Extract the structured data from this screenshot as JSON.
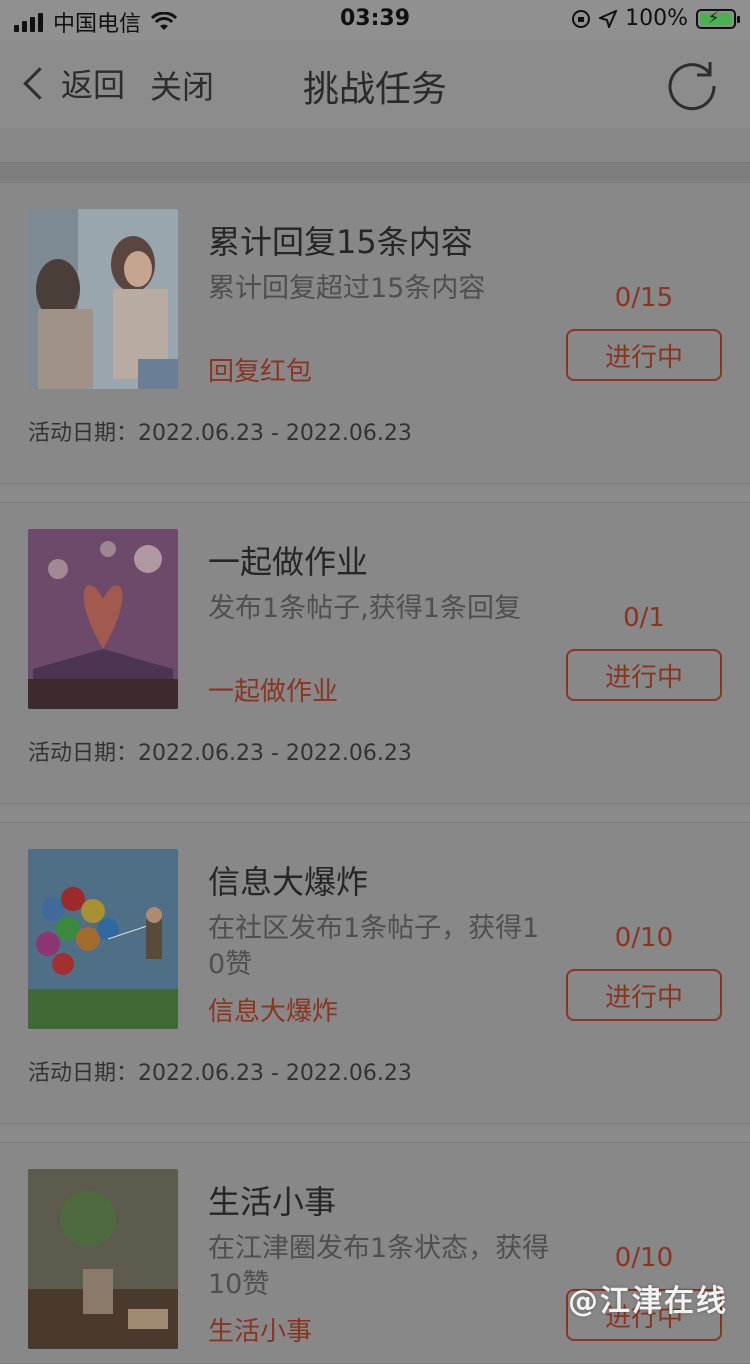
{
  "status_bar": {
    "carrier": "中国电信",
    "time": "03:39",
    "battery": "100%"
  },
  "nav": {
    "back_label": "返回",
    "close_label": "关闭",
    "title": "挑战任务"
  },
  "date_prefix": "活动日期：",
  "tasks": [
    {
      "title": "累计回复15条内容",
      "desc": "累计回复超过15条内容",
      "tag": "回复红包",
      "progress": "0/15",
      "status": "进行中",
      "date": "2022.06.23 - 2022.06.23"
    },
    {
      "title": "一起做作业",
      "desc": "发布1条帖子,获得1条回复",
      "tag": "一起做作业",
      "progress": "0/1",
      "status": "进行中",
      "date": "2022.06.23 - 2022.06.23"
    },
    {
      "title": "信息大爆炸",
      "desc": "在社区发布1条帖子，获得1 0赞",
      "tag": "信息大爆炸",
      "progress": "0/10",
      "status": "进行中",
      "date": "2022.06.23 - 2022.06.23"
    },
    {
      "title": "生活小事",
      "desc": "在江津圈发布1条状态，获得10赞",
      "tag": "生活小事",
      "progress": "0/10",
      "status": "进行中",
      "date": ""
    }
  ],
  "watermark": "@江津在线",
  "colors": {
    "accent": "#8a3422",
    "overlay": "#888888"
  }
}
